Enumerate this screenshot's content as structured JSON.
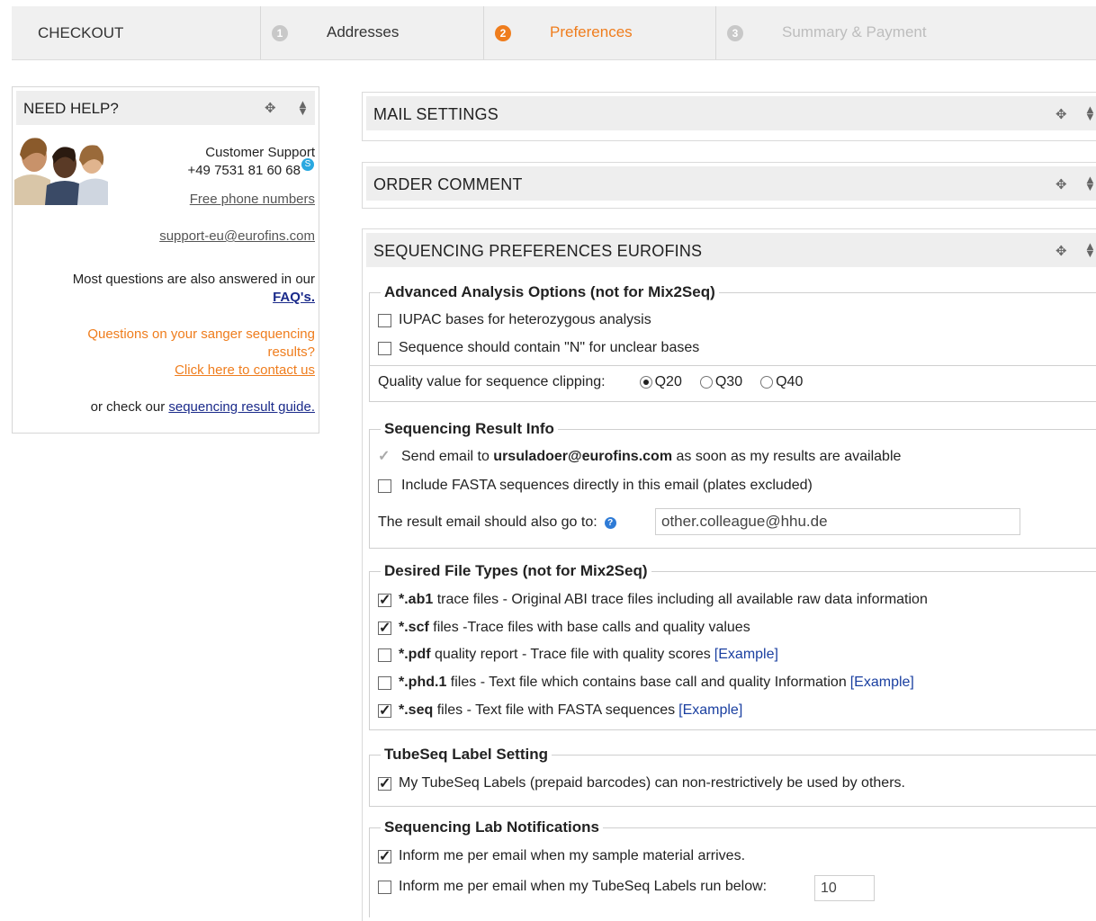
{
  "steps": {
    "checkout": "CHECKOUT",
    "items": [
      {
        "num": "1",
        "label": "Addresses"
      },
      {
        "num": "2",
        "label": "Preferences"
      },
      {
        "num": "3",
        "label": "Summary & Payment"
      }
    ]
  },
  "help": {
    "title": "NEED HELP?",
    "support_title": "Customer Support",
    "phone": "+49 7531 81 60 68",
    "free_numbers": "Free phone numbers",
    "email": "support-eu@eurofins.com",
    "faq_text": "Most questions are also answered in our",
    "faq_link": "FAQ's.",
    "sanger_text_1": "Questions on your sanger sequencing",
    "sanger_text_2": "results?",
    "contact_link": "Click here to contact us",
    "guide_text": "or check our",
    "guide_link": "sequencing result guide."
  },
  "panels": {
    "mail": "MAIL SETTINGS",
    "comment": "ORDER COMMENT",
    "sequencing": "SEQUENCING PREFERENCES EUROFINS"
  },
  "advanced": {
    "legend": "Advanced Analysis Options (not for Mix2Seq)",
    "iupac": "IUPAC bases for heterozygous analysis",
    "n_unclear": "Sequence should contain \"N\" for unclear bases",
    "quality_label": "Quality value for sequence clipping:",
    "quality_options": [
      "Q20",
      "Q30",
      "Q40"
    ],
    "quality_selected": "Q20"
  },
  "result_info": {
    "legend": "Sequencing Result Info",
    "send_prefix": "Send email to",
    "send_email": "ursuladoer@eurofins.com",
    "send_suffix": "as soon as my results are available",
    "fasta": "Include FASTA sequences directly in this email (plates excluded)",
    "also_label": "The result email should also go to:",
    "also_value": "other.colleague@hhu.de"
  },
  "file_types": {
    "legend": "Desired File Types (not for Mix2Seq)",
    "example": "[Example]",
    "items": [
      {
        "ext": "*.ab1",
        "desc": "trace files - Original ABI trace files including all available raw data information",
        "checked": true
      },
      {
        "ext": "*.scf",
        "desc": "files -Trace files with base calls and quality values",
        "checked": true
      },
      {
        "ext": "*.pdf",
        "desc": "quality report - Trace file with quality scores",
        "checked": false
      },
      {
        "ext": "*.phd.1",
        "desc": "files - Text file which contains base call and quality Information",
        "checked": false
      },
      {
        "ext": "*.seq",
        "desc": "files - Text file with FASTA sequences",
        "checked": true
      }
    ]
  },
  "tubeseq": {
    "legend": "TubeSeq Label Setting",
    "label": "My TubeSeq Labels (prepaid barcodes) can non-restrictively be used by others."
  },
  "lab": {
    "legend": "Sequencing Lab Notifications",
    "arrive": "Inform me per email when my sample material arrives.",
    "below": "Inform me per email when my TubeSeq Labels run below:",
    "below_value": "10"
  }
}
